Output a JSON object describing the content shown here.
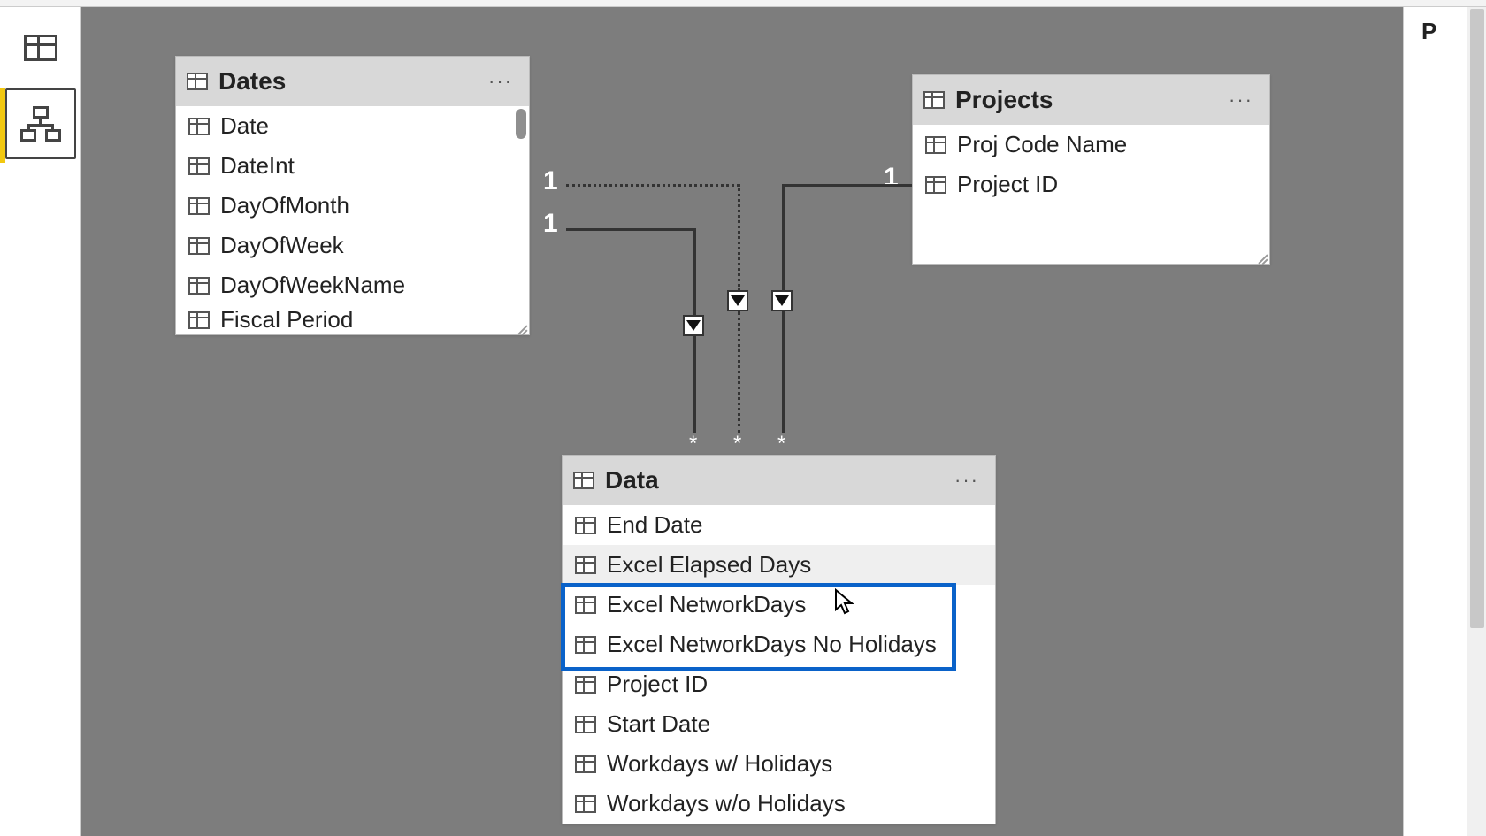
{
  "nav": {
    "data_view": "Data view",
    "model_view": "Model view"
  },
  "cards": {
    "dates": {
      "title": "Dates",
      "fields": [
        "Date",
        "DateInt",
        "DayOfMonth",
        "DayOfWeek",
        "DayOfWeekName",
        "Fiscal Period"
      ]
    },
    "projects": {
      "title": "Projects",
      "fields": [
        "Proj Code Name",
        "Project ID"
      ]
    },
    "data": {
      "title": "Data",
      "fields": [
        "End Date",
        "Excel Elapsed Days",
        "Excel NetworkDays",
        "Excel NetworkDays No Holidays",
        "Project ID",
        "Start Date",
        "Workdays w/ Holidays",
        "Workdays w/o Holidays"
      ]
    }
  },
  "rel": {
    "one": "1",
    "many": "*"
  },
  "more": "···",
  "panel_right": "P"
}
